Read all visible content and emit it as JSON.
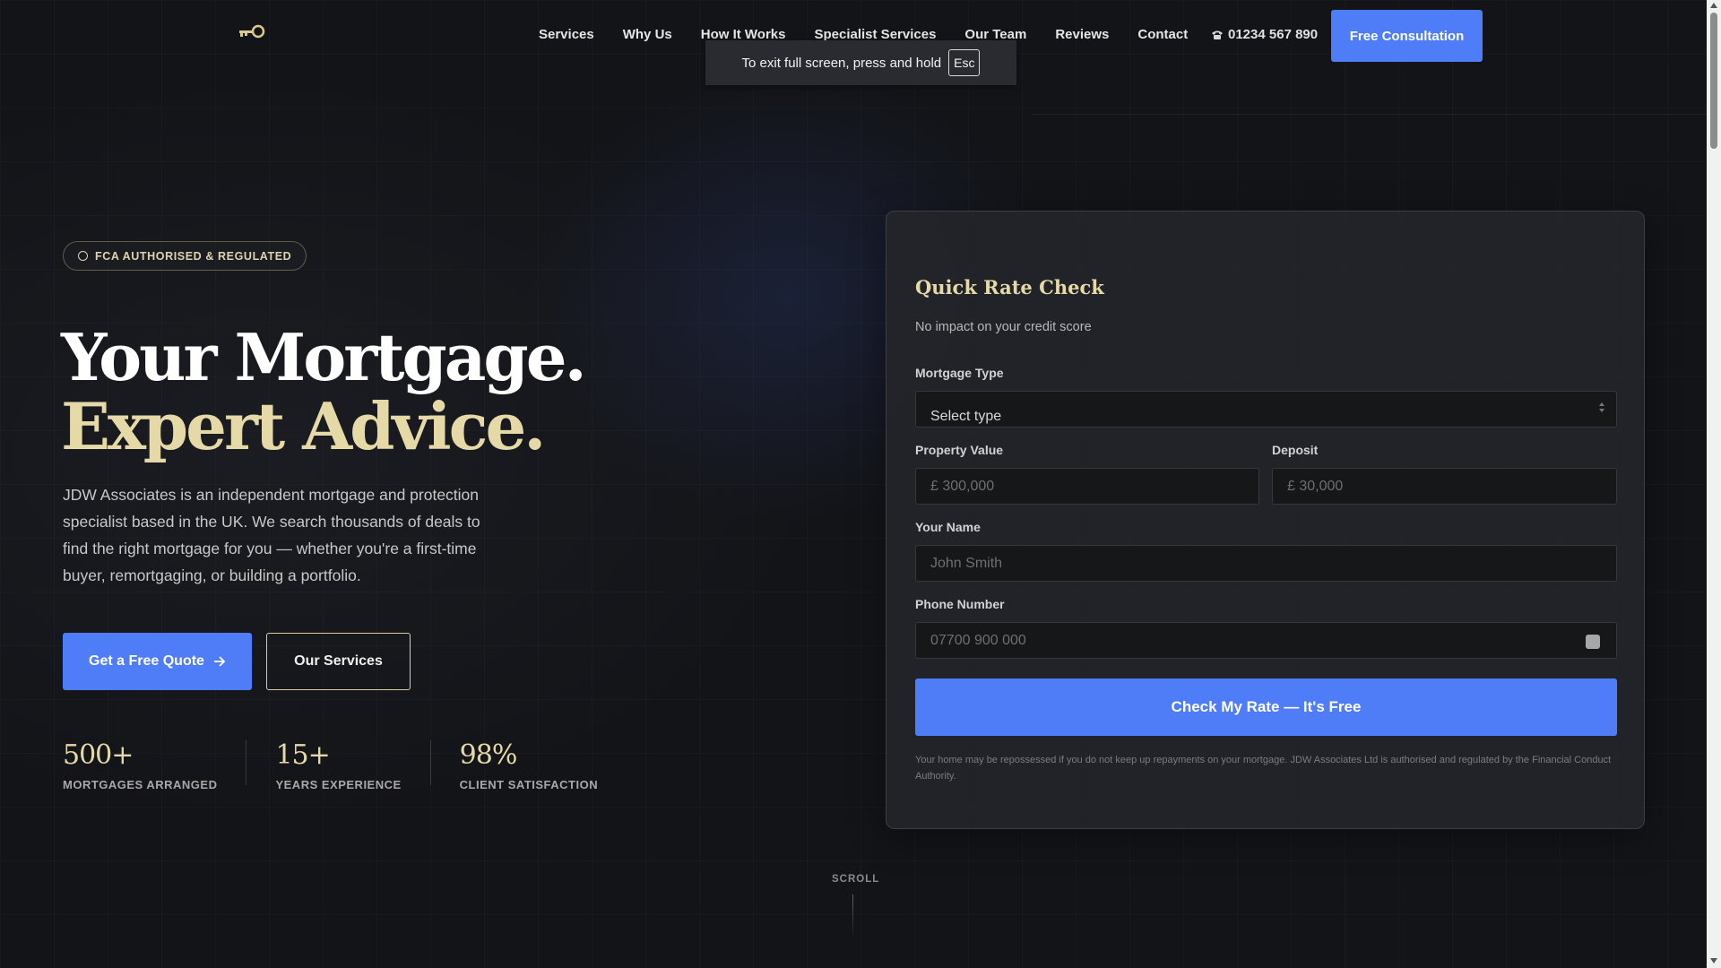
{
  "nav": {
    "logo_icon": "key-icon",
    "links": [
      "Services",
      "Why Us",
      "How It Works",
      "Specialist Services",
      "Our Team",
      "Reviews",
      "Contact"
    ],
    "phone": "01234 567 890",
    "phone_icon": "telephone-icon",
    "cta": "Free Consultation"
  },
  "toast": {
    "text": "To exit full screen, press and hold",
    "key": "Esc"
  },
  "hero": {
    "badge": "FCA AUTHORISED & REGULATED",
    "badge_icon": "check-circle-icon",
    "title_line1": "Your Mortgage.",
    "title_line2": "Expert Advice.",
    "lead": "JDW Associates is an independent mortgage and protection specialist based in the UK. We search thousands of deals to find the right mortgage for you — whether you're a first-time buyer, remortgaging, or building a portfolio.",
    "primary_button": "Get a Free Quote",
    "primary_button_icon": "arrow-right-icon",
    "secondary_button": "Our Services",
    "stats": [
      {
        "value": "500+",
        "label": "MORTGAGES ARRANGED"
      },
      {
        "value": "15+",
        "label": "YEARS EXPERIENCE"
      },
      {
        "value": "98%",
        "label": "CLIENT SATISFACTION"
      }
    ]
  },
  "form": {
    "title": "Quick Rate Check",
    "subtitle": "No impact on your credit score",
    "mortgage_type_label": "Mortgage Type",
    "mortgage_type_value": "Select type",
    "property_value_label": "Property Value",
    "property_value_placeholder": "£ 300,000",
    "deposit_label": "Deposit",
    "deposit_placeholder": "£ 30,000",
    "name_label": "Your Name",
    "name_placeholder": "John Smith",
    "phone_label": "Phone Number",
    "phone_placeholder": "07700 900 000",
    "submit": "Check My Rate — It's Free",
    "disclaimer": "Your home may be repossessed if you do not keep up repayments on your mortgage. JDW Associates Ltd is authorised and regulated by the Financial Conduct Authority."
  },
  "scroll_label": "SCROLL",
  "colors": {
    "accent": "#4f7cf7",
    "gold": "#e5d9a8",
    "background": "#131418"
  }
}
